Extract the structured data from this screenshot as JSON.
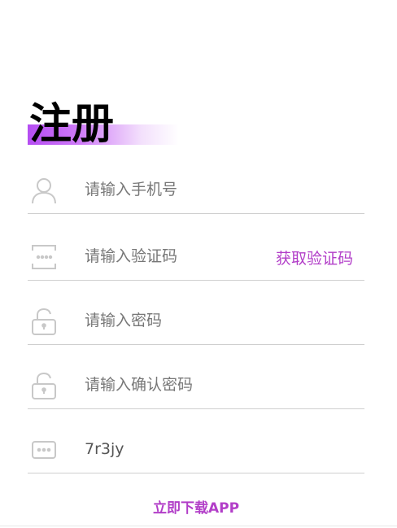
{
  "header": {
    "title": "注册"
  },
  "form": {
    "phone": {
      "placeholder": "请输入手机号",
      "icon": "user-icon"
    },
    "code": {
      "placeholder": "请输入验证码",
      "icon": "code-icon",
      "get_code_label": "获取验证码"
    },
    "password": {
      "placeholder": "请输入密码",
      "icon": "lock-icon"
    },
    "confirm_password": {
      "placeholder": "请输入确认密码",
      "icon": "lock-icon"
    },
    "captcha": {
      "value": "7r3jy",
      "icon": "captcha-icon"
    }
  },
  "footer": {
    "download_label": "立即下载APP"
  },
  "colors": {
    "accent": "#b23ec8",
    "divider": "#cfcfcf",
    "icon": "#c8c8c8"
  }
}
